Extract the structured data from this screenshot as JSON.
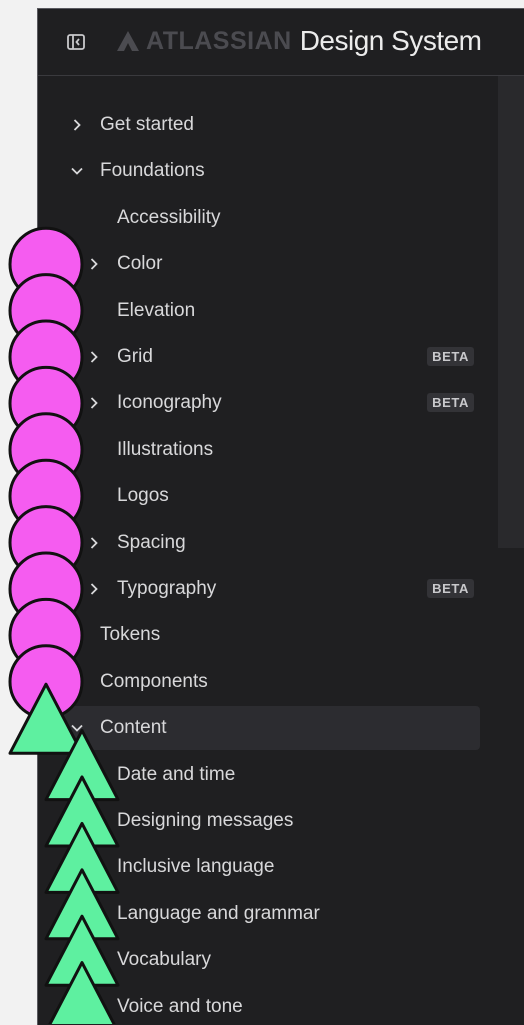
{
  "header": {
    "panel_toggle_icon": "sidebar-collapse-icon",
    "brand_logo_icon": "atlassian-logo-icon",
    "brand_company": "ATLASSIAN",
    "brand_product": "Design System"
  },
  "colors": {
    "background": "#1f1f21",
    "text": "#d8d8da",
    "muted_brand": "#4b4b50",
    "badge_bg": "#333337",
    "selected_bg": "#2c2c30",
    "circle_marker": "#f55cf0",
    "triangle_marker": "#5ef0a0"
  },
  "nav": {
    "items": [
      {
        "label": "Get started",
        "chevron": "right",
        "level": 0,
        "badge": ""
      },
      {
        "label": "Foundations",
        "chevron": "down",
        "level": 0,
        "badge": ""
      },
      {
        "label": "Accessibility",
        "chevron": "",
        "level": 1,
        "badge": ""
      },
      {
        "label": "Color",
        "chevron": "right",
        "level": 1,
        "badge": ""
      },
      {
        "label": "Elevation",
        "chevron": "",
        "level": 1,
        "badge": ""
      },
      {
        "label": "Grid",
        "chevron": "right",
        "level": 1,
        "badge": "BETA"
      },
      {
        "label": "Iconography",
        "chevron": "right",
        "level": 1,
        "badge": "BETA"
      },
      {
        "label": "Illustrations",
        "chevron": "",
        "level": 1,
        "badge": ""
      },
      {
        "label": "Logos",
        "chevron": "",
        "level": 1,
        "badge": ""
      },
      {
        "label": "Spacing",
        "chevron": "right",
        "level": 1,
        "badge": ""
      },
      {
        "label": "Typography",
        "chevron": "right",
        "level": 1,
        "badge": "BETA"
      },
      {
        "label": "Tokens",
        "chevron": "",
        "level": 0,
        "badge": ""
      },
      {
        "label": "Components",
        "chevron": "",
        "level": 0,
        "badge": ""
      },
      {
        "label": "Content",
        "chevron": "down",
        "level": 0,
        "badge": "",
        "selected": true
      },
      {
        "label": "Date and time",
        "chevron": "",
        "level": 1,
        "badge": ""
      },
      {
        "label": "Designing messages",
        "chevron": "",
        "level": 1,
        "badge": ""
      },
      {
        "label": "Inclusive language",
        "chevron": "",
        "level": 1,
        "badge": ""
      },
      {
        "label": "Language and grammar",
        "chevron": "",
        "level": 1,
        "badge": ""
      },
      {
        "label": "Vocabulary",
        "chevron": "",
        "level": 1,
        "badge": ""
      },
      {
        "label": "Voice and tone",
        "chevron": "",
        "level": 1,
        "badge": ""
      }
    ]
  }
}
